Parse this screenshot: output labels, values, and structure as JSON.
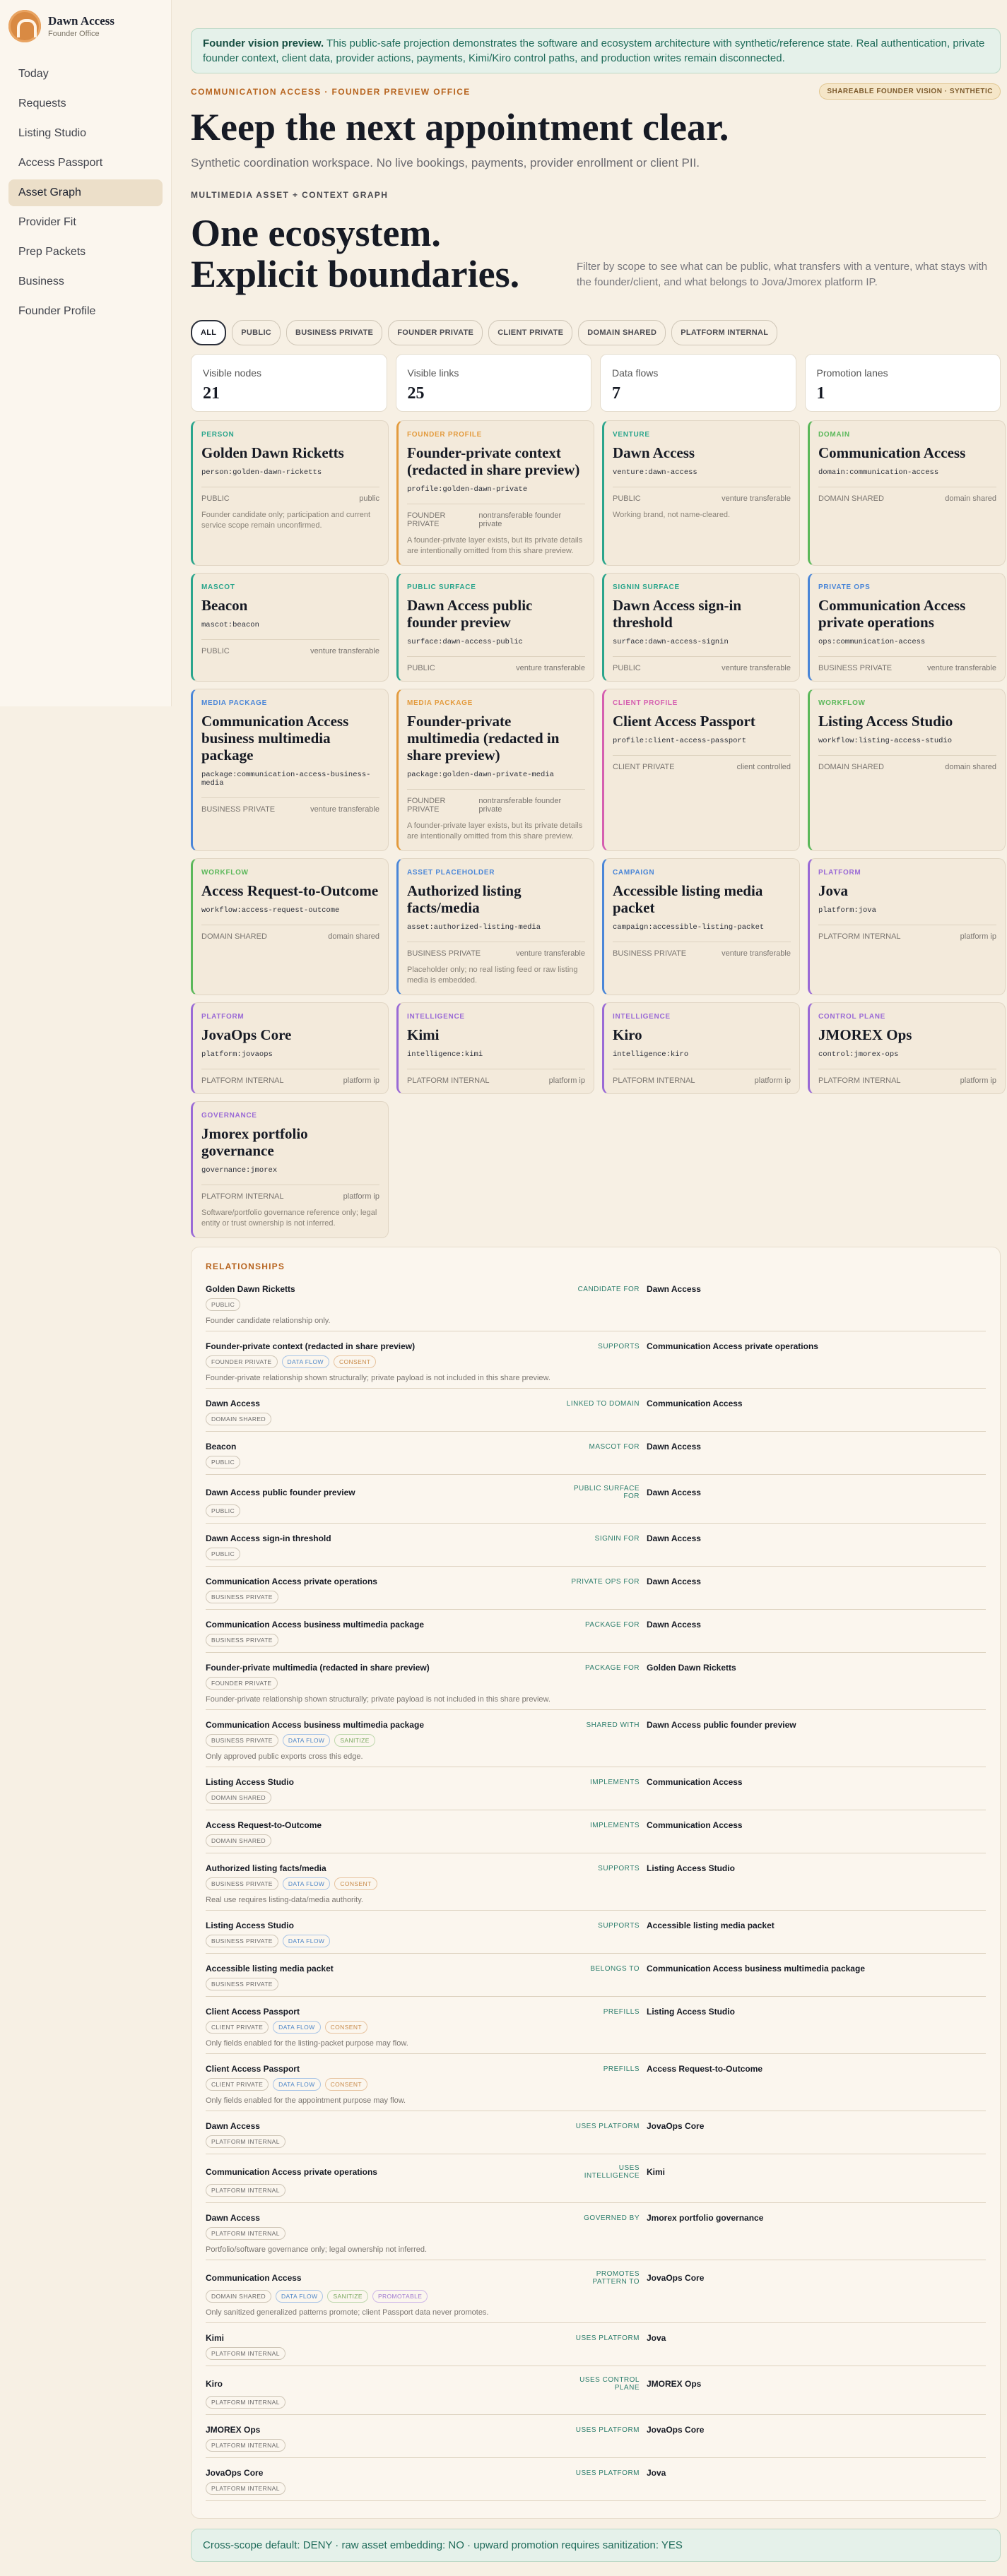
{
  "brand": {
    "name": "Dawn Access",
    "subtitle": "Founder Office",
    "logo_icon": "dawn-arch-icon"
  },
  "nav": [
    {
      "label": "Today"
    },
    {
      "label": "Requests"
    },
    {
      "label": "Listing Studio"
    },
    {
      "label": "Access Passport"
    },
    {
      "label": "Asset Graph",
      "active": true
    },
    {
      "label": "Provider Fit"
    },
    {
      "label": "Prep Packets"
    },
    {
      "label": "Business"
    },
    {
      "label": "Founder Profile"
    }
  ],
  "banner": {
    "lead": "Founder vision preview.",
    "text": " This public-safe projection demonstrates the software and ecosystem architecture with synthetic/reference state. Real authentication, private founder context, client data, provider actions, payments, Kimi/Kiro control paths, and production writes remain disconnected."
  },
  "header": {
    "kicker": "COMMUNICATION ACCESS · FOUNDER PREVIEW OFFICE",
    "badge": "SHAREABLE FOUNDER VISION · SYNTHETIC",
    "title": "Keep the next appointment clear.",
    "subtitle": "Synthetic coordination workspace. No live bookings, payments, provider enrollment or client PII."
  },
  "ecosystem": {
    "kicker": "MULTIMEDIA ASSET + CONTEXT GRAPH",
    "title": "One ecosystem. Explicit boundaries.",
    "description": "Filter by scope to see what can be public, what transfers with a venture, what stays with the founder/client, and what belongs to Jova/Jmorex platform IP."
  },
  "filters": [
    {
      "label": "ALL",
      "active": true
    },
    {
      "label": "PUBLIC"
    },
    {
      "label": "BUSINESS PRIVATE"
    },
    {
      "label": "FOUNDER PRIVATE"
    },
    {
      "label": "CLIENT PRIVATE"
    },
    {
      "label": "DOMAIN SHARED"
    },
    {
      "label": "PLATFORM INTERNAL"
    }
  ],
  "stats": [
    {
      "label": "Visible nodes",
      "value": "21"
    },
    {
      "label": "Visible links",
      "value": "25"
    },
    {
      "label": "Data flows",
      "value": "7"
    },
    {
      "label": "Promotion lanes",
      "value": "1"
    }
  ],
  "colors": {
    "teal": "#2aa58c",
    "orange": "#e39b3e",
    "pink": "#d55fb0",
    "blue": "#4a86d8",
    "green": "#5bb85a",
    "purple": "#9a6ad6"
  },
  "nodes": [
    {
      "type": "PERSON",
      "color": "teal",
      "title": "Golden Dawn Ricketts",
      "id": "person:golden-dawn-ricketts",
      "scope": "PUBLIC",
      "transfer": "public",
      "note": "Founder candidate only; participation and current service scope remain unconfirmed."
    },
    {
      "type": "FOUNDER PROFILE",
      "color": "orange",
      "title": "Founder-private context (redacted in share preview)",
      "id": "profile:golden-dawn-private",
      "scope": "FOUNDER PRIVATE",
      "transfer": "nontransferable founder private",
      "note": "A founder-private layer exists, but its private details are intentionally omitted from this share preview."
    },
    {
      "type": "VENTURE",
      "color": "teal",
      "title": "Dawn Access",
      "id": "venture:dawn-access",
      "scope": "PUBLIC",
      "transfer": "venture transferable",
      "note": "Working brand, not name-cleared."
    },
    {
      "type": "DOMAIN",
      "color": "green",
      "title": "Communication Access",
      "id": "domain:communication-access",
      "scope": "DOMAIN SHARED",
      "transfer": "domain shared",
      "note": ""
    },
    {
      "type": "MASCOT",
      "color": "teal",
      "title": "Beacon",
      "id": "mascot:beacon",
      "scope": "PUBLIC",
      "transfer": "venture transferable",
      "note": ""
    },
    {
      "type": "PUBLIC SURFACE",
      "color": "teal",
      "title": "Dawn Access public founder preview",
      "id": "surface:dawn-access-public",
      "scope": "PUBLIC",
      "transfer": "venture transferable",
      "note": ""
    },
    {
      "type": "SIGNIN SURFACE",
      "color": "teal",
      "title": "Dawn Access sign-in threshold",
      "id": "surface:dawn-access-signin",
      "scope": "PUBLIC",
      "transfer": "venture transferable",
      "note": ""
    },
    {
      "type": "PRIVATE OPS",
      "color": "blue",
      "title": "Communication Access private operations",
      "id": "ops:communication-access",
      "scope": "BUSINESS PRIVATE",
      "transfer": "venture transferable",
      "note": ""
    },
    {
      "type": "MEDIA PACKAGE",
      "color": "blue",
      "title": "Communication Access business multimedia package",
      "id": "package:communication-access-business-media",
      "scope": "BUSINESS PRIVATE",
      "transfer": "venture transferable",
      "note": ""
    },
    {
      "type": "MEDIA PACKAGE",
      "color": "orange",
      "title": "Founder-private multimedia (redacted in share preview)",
      "id": "package:golden-dawn-private-media",
      "scope": "FOUNDER PRIVATE",
      "transfer": "nontransferable founder private",
      "note": "A founder-private layer exists, but its private details are intentionally omitted from this share preview."
    },
    {
      "type": "CLIENT PROFILE",
      "color": "pink",
      "title": "Client Access Passport",
      "id": "profile:client-access-passport",
      "scope": "CLIENT PRIVATE",
      "transfer": "client controlled",
      "note": ""
    },
    {
      "type": "WORKFLOW",
      "color": "green",
      "title": "Listing Access Studio",
      "id": "workflow:listing-access-studio",
      "scope": "DOMAIN SHARED",
      "transfer": "domain shared",
      "note": ""
    },
    {
      "type": "WORKFLOW",
      "color": "green",
      "title": "Access Request-to-Outcome",
      "id": "workflow:access-request-outcome",
      "scope": "DOMAIN SHARED",
      "transfer": "domain shared",
      "note": ""
    },
    {
      "type": "ASSET PLACEHOLDER",
      "color": "blue",
      "title": "Authorized listing facts/media",
      "id": "asset:authorized-listing-media",
      "scope": "BUSINESS PRIVATE",
      "transfer": "venture transferable",
      "note": "Placeholder only; no real listing feed or raw listing media is embedded."
    },
    {
      "type": "CAMPAIGN",
      "color": "blue",
      "title": "Accessible listing media packet",
      "id": "campaign:accessible-listing-packet",
      "scope": "BUSINESS PRIVATE",
      "transfer": "venture transferable",
      "note": ""
    },
    {
      "type": "PLATFORM",
      "color": "purple",
      "title": "Jova",
      "id": "platform:jova",
      "scope": "PLATFORM INTERNAL",
      "transfer": "platform ip",
      "note": ""
    },
    {
      "type": "PLATFORM",
      "color": "purple",
      "title": "JovaOps Core",
      "id": "platform:jovaops",
      "scope": "PLATFORM INTERNAL",
      "transfer": "platform ip",
      "note": ""
    },
    {
      "type": "INTELLIGENCE",
      "color": "purple",
      "title": "Kimi",
      "id": "intelligence:kimi",
      "scope": "PLATFORM INTERNAL",
      "transfer": "platform ip",
      "note": ""
    },
    {
      "type": "INTELLIGENCE",
      "color": "purple",
      "title": "Kiro",
      "id": "intelligence:kiro",
      "scope": "PLATFORM INTERNAL",
      "transfer": "platform ip",
      "note": ""
    },
    {
      "type": "CONTROL PLANE",
      "color": "purple",
      "title": "JMOREX Ops",
      "id": "control:jmorex-ops",
      "scope": "PLATFORM INTERNAL",
      "transfer": "platform ip",
      "note": ""
    },
    {
      "type": "GOVERNANCE",
      "color": "purple",
      "title": "Jmorex portfolio governance",
      "id": "governance:jmorex",
      "scope": "PLATFORM INTERNAL",
      "transfer": "platform ip",
      "note": "Software/portfolio governance reference only; legal entity or trust ownership is not inferred."
    }
  ],
  "relationships_title": "RELATIONSHIPS",
  "relationships": [
    {
      "from": "Golden Dawn Ricketts",
      "verb": "CANDIDATE FOR",
      "to": "Dawn Access",
      "tags": [
        "PUBLIC"
      ],
      "note": "Founder candidate relationship only."
    },
    {
      "from": "Founder-private context (redacted in share preview)",
      "verb": "SUPPORTS",
      "to": "Communication Access private operations",
      "tags": [
        "FOUNDER PRIVATE",
        "DATA FLOW",
        "CONSENT"
      ],
      "note": "Founder-private relationship shown structurally; private payload is not included in this share preview."
    },
    {
      "from": "Dawn Access",
      "verb": "LINKED TO DOMAIN",
      "to": "Communication Access",
      "tags": [
        "DOMAIN SHARED"
      ],
      "note": ""
    },
    {
      "from": "Beacon",
      "verb": "MASCOT FOR",
      "to": "Dawn Access",
      "tags": [
        "PUBLIC"
      ],
      "note": ""
    },
    {
      "from": "Dawn Access public founder preview",
      "verb": "PUBLIC SURFACE FOR",
      "to": "Dawn Access",
      "tags": [
        "PUBLIC"
      ],
      "note": ""
    },
    {
      "from": "Dawn Access sign-in threshold",
      "verb": "SIGNIN FOR",
      "to": "Dawn Access",
      "tags": [
        "PUBLIC"
      ],
      "note": ""
    },
    {
      "from": "Communication Access private operations",
      "verb": "PRIVATE OPS FOR",
      "to": "Dawn Access",
      "tags": [
        "BUSINESS PRIVATE"
      ],
      "note": ""
    },
    {
      "from": "Communication Access business multimedia package",
      "verb": "PACKAGE FOR",
      "to": "Dawn Access",
      "tags": [
        "BUSINESS PRIVATE"
      ],
      "note": ""
    },
    {
      "from": "Founder-private multimedia (redacted in share preview)",
      "verb": "PACKAGE FOR",
      "to": "Golden Dawn Ricketts",
      "tags": [
        "FOUNDER PRIVATE"
      ],
      "note": "Founder-private relationship shown structurally; private payload is not included in this share preview."
    },
    {
      "from": "Communication Access business multimedia package",
      "verb": "SHARED WITH",
      "to": "Dawn Access public founder preview",
      "tags": [
        "BUSINESS PRIVATE",
        "DATA FLOW",
        "SANITIZE"
      ],
      "note": "Only approved public exports cross this edge."
    },
    {
      "from": "Listing Access Studio",
      "verb": "IMPLEMENTS",
      "to": "Communication Access",
      "tags": [
        "DOMAIN SHARED"
      ],
      "note": ""
    },
    {
      "from": "Access Request-to-Outcome",
      "verb": "IMPLEMENTS",
      "to": "Communication Access",
      "tags": [
        "DOMAIN SHARED"
      ],
      "note": ""
    },
    {
      "from": "Authorized listing facts/media",
      "verb": "SUPPORTS",
      "to": "Listing Access Studio",
      "tags": [
        "BUSINESS PRIVATE",
        "DATA FLOW",
        "CONSENT"
      ],
      "note": "Real use requires listing-data/media authority."
    },
    {
      "from": "Listing Access Studio",
      "verb": "SUPPORTS",
      "to": "Accessible listing media packet",
      "tags": [
        "BUSINESS PRIVATE",
        "DATA FLOW"
      ],
      "note": ""
    },
    {
      "from": "Accessible listing media packet",
      "verb": "BELONGS TO",
      "to": "Communication Access business multimedia package",
      "tags": [
        "BUSINESS PRIVATE"
      ],
      "note": ""
    },
    {
      "from": "Client Access Passport",
      "verb": "PREFILLS",
      "to": "Listing Access Studio",
      "tags": [
        "CLIENT PRIVATE",
        "DATA FLOW",
        "CONSENT"
      ],
      "note": "Only fields enabled for the listing-packet purpose may flow."
    },
    {
      "from": "Client Access Passport",
      "verb": "PREFILLS",
      "to": "Access Request-to-Outcome",
      "tags": [
        "CLIENT PRIVATE",
        "DATA FLOW",
        "CONSENT"
      ],
      "note": "Only fields enabled for the appointment purpose may flow."
    },
    {
      "from": "Dawn Access",
      "verb": "USES PLATFORM",
      "to": "JovaOps Core",
      "tags": [
        "PLATFORM INTERNAL"
      ],
      "note": ""
    },
    {
      "from": "Communication Access private operations",
      "verb": "USES INTELLIGENCE",
      "to": "Kimi",
      "tags": [
        "PLATFORM INTERNAL"
      ],
      "note": ""
    },
    {
      "from": "Dawn Access",
      "verb": "GOVERNED BY",
      "to": "Jmorex portfolio governance",
      "tags": [
        "PLATFORM INTERNAL"
      ],
      "note": "Portfolio/software governance only; legal ownership not inferred."
    },
    {
      "from": "Communication Access",
      "verb": "PROMOTES PATTERN TO",
      "to": "JovaOps Core",
      "tags": [
        "DOMAIN SHARED",
        "DATA FLOW",
        "SANITIZE",
        "PROMOTABLE"
      ],
      "note": "Only sanitized generalized patterns promote; client Passport data never promotes."
    },
    {
      "from": "Kimi",
      "verb": "USES PLATFORM",
      "to": "Jova",
      "tags": [
        "PLATFORM INTERNAL"
      ],
      "note": ""
    },
    {
      "from": "Kiro",
      "verb": "USES CONTROL PLANE",
      "to": "JMOREX Ops",
      "tags": [
        "PLATFORM INTERNAL"
      ],
      "note": ""
    },
    {
      "from": "JMOREX Ops",
      "verb": "USES PLATFORM",
      "to": "JovaOps Core",
      "tags": [
        "PLATFORM INTERNAL"
      ],
      "note": ""
    },
    {
      "from": "JovaOps Core",
      "verb": "USES PLATFORM",
      "to": "Jova",
      "tags": [
        "PLATFORM INTERNAL"
      ],
      "note": ""
    }
  ],
  "footer": "Cross-scope default: DENY · raw asset embedding: NO · upward promotion requires sanitization: YES"
}
